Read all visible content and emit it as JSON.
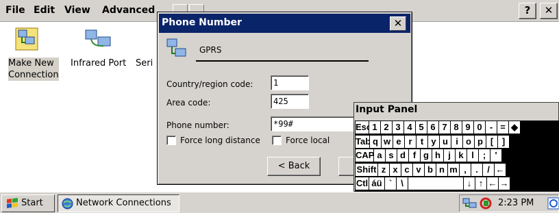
{
  "menubar": {
    "items": [
      "File",
      "Edit",
      "View",
      "Advanced"
    ],
    "help_label": "?",
    "close_label": "✕"
  },
  "desktop": {
    "icons": [
      {
        "label_line1": "Make New",
        "label_line2": "Connection"
      },
      {
        "label_line1": "Infrared Port",
        "label_line2": ""
      },
      {
        "label_line1": "Seri",
        "label_line2": ""
      }
    ]
  },
  "dialog": {
    "title": "Phone Number",
    "close_label": "✕",
    "connection_name": "GPRS",
    "country_label": "Country/region code:",
    "country_value": "1",
    "area_label": "Area code:",
    "area_value": "425",
    "phone_label": "Phone number:",
    "phone_value": "*99#",
    "force_long_label": "Force long distance",
    "force_local_label": "Force local",
    "back_label": "< Back"
  },
  "input_panel": {
    "title": "Input Panel",
    "rows": [
      [
        "Esc",
        "1",
        "2",
        "3",
        "4",
        "5",
        "6",
        "7",
        "8",
        "9",
        "0",
        "-",
        "=",
        "◆"
      ],
      [
        "Tab",
        "q",
        "w",
        "e",
        "r",
        "t",
        "y",
        "u",
        "i",
        "o",
        "p",
        "[",
        "]"
      ],
      [
        "CAP",
        "a",
        "s",
        "d",
        "f",
        "g",
        "h",
        "j",
        "k",
        "l",
        ";",
        "'"
      ],
      [
        "Shift",
        "z",
        "x",
        "c",
        "v",
        "b",
        "n",
        "m",
        ",",
        ".",
        "/",
        "←"
      ],
      [
        "Ctl",
        "áü",
        "`",
        "\\",
        "",
        "↓",
        "↑",
        "←",
        "→"
      ]
    ]
  },
  "taskbar": {
    "start_label": "Start",
    "task_label": "Network Connections",
    "clock": "2:23 PM"
  }
}
